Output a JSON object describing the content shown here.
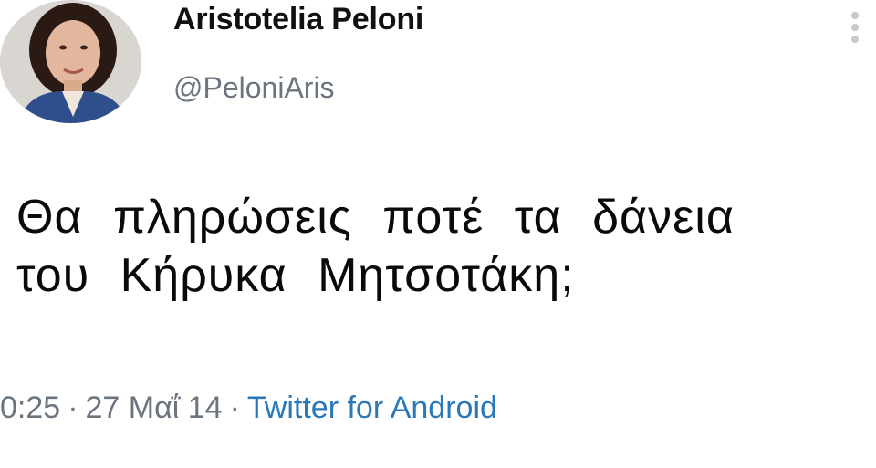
{
  "user": {
    "display_name": "Aristotelia Peloni",
    "handle": "@PeloniAris"
  },
  "tweet": {
    "line1": "Θα πληρώσεις ποτέ τα δάνεια",
    "line2": "του Κήρυκα Μητσοτάκη;"
  },
  "meta": {
    "time": "0:25",
    "separator": "·",
    "date": "27 Μαΐ 14",
    "source": "Twitter for Android"
  },
  "icons": {
    "avatar": "profile-photo",
    "more": "vertical-dots-icon"
  },
  "colors": {
    "handle": "#6b7580",
    "source_link": "#2a78b8",
    "text": "#0a0a0a"
  }
}
